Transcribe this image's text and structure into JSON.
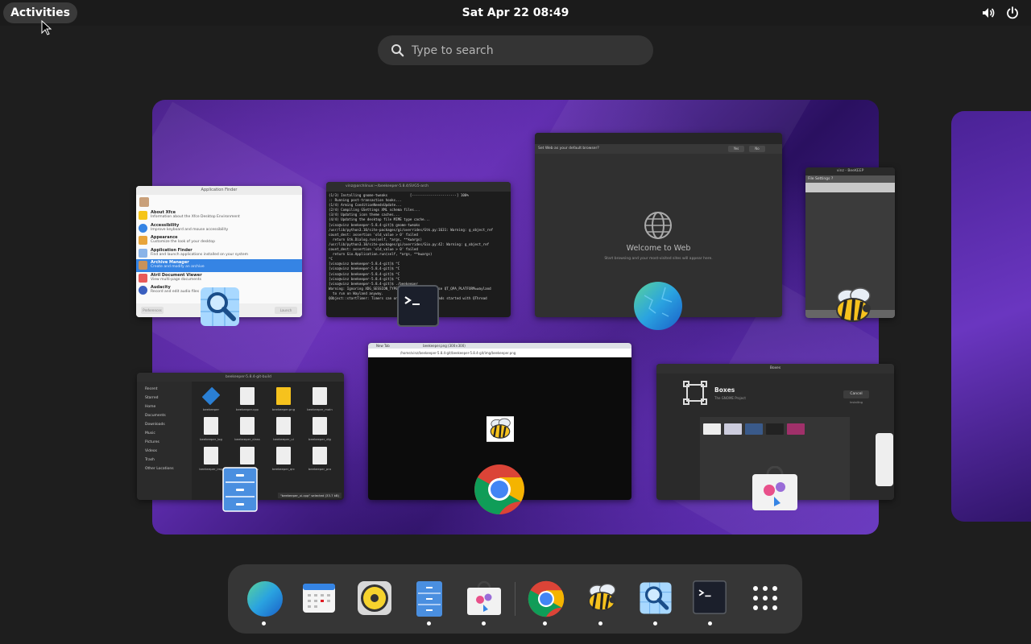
{
  "topbar": {
    "activities_label": "Activities",
    "clock": "Sat Apr 22  08:49"
  },
  "search": {
    "placeholder": "Type to search"
  },
  "windows": {
    "app_finder": {
      "title": "Application Finder",
      "items": [
        {
          "title": "About Xfce",
          "desc": "Information about the Xfce Desktop Environment"
        },
        {
          "title": "Accessibility",
          "desc": "Improve keyboard and mouse accessibility"
        },
        {
          "title": "Appearance",
          "desc": "Customize the look of your desktop"
        },
        {
          "title": "Application Finder",
          "desc": "Find and launch applications installed on your system"
        },
        {
          "title": "Archive Manager",
          "desc": "Create and modify an archive"
        },
        {
          "title": "Atril Document Viewer",
          "desc": "View multi-page documents"
        },
        {
          "title": "Audacity",
          "desc": "Record and edit audio files"
        }
      ],
      "footer_left": "Preferences",
      "footer_right": "Launch"
    },
    "terminal": {
      "title": "vinz@archlinux:~/beekeeper-5.8.4/SVG5-arch",
      "lines": [
        "(1/3) Installing gnome-tweaks           [----------------------] 100%",
        ":: Running post-transaction hooks...",
        "(1/4) Arming ConditionNeedsUpdate...",
        "(2/4) Compiling GSettings XML schema files...",
        "(3/4) Updating icon theme caches...",
        "(4/4) Updating the desktop file MIME type cache...",
        "[vinz@vinz beekeeper-5.8.4-git]$ gnome-tweaks",
        "/usr/lib/python3.10/site-packages/gi/overrides/Gtk.py:1631: Warning: g_object_ref",
        "count_dest: assertion 'old_value > 0' failed",
        "  return Gtk.Dialog.run(self, *args, **kwargs)",
        "/usr/lib/python3.10/site-packages/gi/overrides/Gio.py:42: Warning: g_object_ref",
        "count_dest: assertion 'old_value > 0' failed",
        "  return Gio.Application.run(self, *args, **kwargs)",
        "^C",
        "[vinz@vinz beekeeper-5.8.4-git]$ ^C",
        "[vinz@vinz beekeeper-5.8.4-git]$ ^C",
        "[vinz@vinz beekeeper-5.8.4-git]$ ^C",
        "[vinz@vinz beekeeper-5.8.4-git]$ ^C",
        "[vinz@vinz beekeeper-5.8.4-git]$ ./beekeeper",
        "Warning: Ignoring XDG_SESSION_TYPE=wayland on Gnome. Use QT_QPA_PLATFORM=wayland",
        "  to run on Wayland anyway.",
        "QObject::startTimer: Timers can only be used with threads started with QThread"
      ]
    },
    "web": {
      "title": "Welcome to Web",
      "subtitle": "Start browsing and your most-visited sites will appear here.",
      "infobar": "Set Web as your default browser?",
      "btn_yes": "Yes",
      "btn_no": "No"
    },
    "beekeeper": {
      "title": "vinz - BeeKEEP",
      "menu": "File  Settings  ?"
    },
    "files": {
      "title": "beekeeper-5.8.4-git-build",
      "sidebar": [
        "Recent",
        "Starred",
        "Home",
        "Documents",
        "Downloads",
        "Music",
        "Pictures",
        "Videos",
        "Trash",
        "Other Locations"
      ],
      "files": [
        "beekeeper",
        "beekeeper.cpp",
        "beekeeper.png",
        "beekeeper_main",
        "beekeeper_log",
        "beekeeper_class",
        "beekeeper_ui",
        "beekeeper_dlg",
        "beekeeper_img",
        "beekeeper_res",
        "beekeeper_qrc",
        "beekeeper_pro"
      ],
      "status": "\"beekeeper_ui.cpp\" selected (33.7 kB)"
    },
    "chrome": {
      "tab": "New Tab",
      "tab2": "beekeeper.png (300×300)",
      "address": "/home/vinz/beekeeper-5.8.4-git/beekeeper-5.8.4-git/img/beekeeper.png"
    },
    "software": {
      "title": "Boxes",
      "app_name": "Boxes",
      "app_sub": "The GNOME Project",
      "cancel": "Cancel",
      "size": "Installing"
    }
  },
  "dash": {
    "apps": [
      "web-browser",
      "calendar",
      "rhythmbox",
      "file-manager",
      "software-center",
      "chrome",
      "beekeeper",
      "image-viewer",
      "terminal",
      "app-grid"
    ]
  },
  "colors": {
    "accent": "#3584e4",
    "panel": "#1b1b1b",
    "dash": "#363636",
    "wallpaper": "#4a2296"
  }
}
